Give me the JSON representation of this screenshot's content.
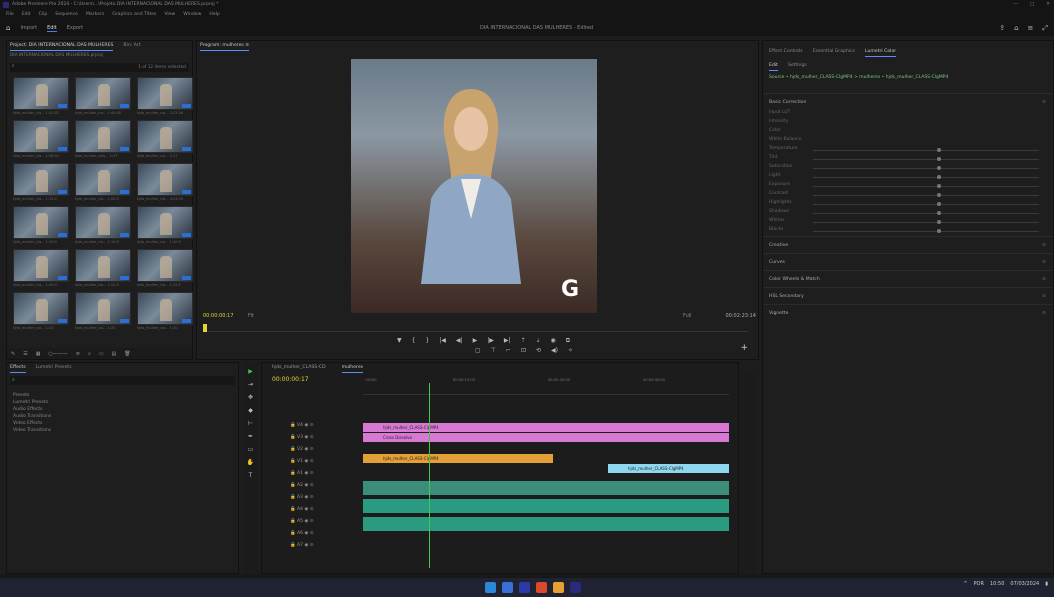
{
  "window": {
    "title": "Adobe Premiere Pro 2024 - C:\\Users\\...\\Projeto DIA INTERNACIONAL DAS MULHERES.prproj *",
    "controls": [
      "—",
      "□",
      "✕"
    ]
  },
  "menu": [
    "File",
    "Edit",
    "Clip",
    "Sequence",
    "Markers",
    "Graphics and Titles",
    "View",
    "Window",
    "Help"
  ],
  "workspace": {
    "tabs": [
      "Import",
      "Edit",
      "Export"
    ],
    "active": "Edit",
    "document_title": "DIA INTERNACIONAL DAS MULHERES - Edited"
  },
  "project": {
    "tab": "Project: DIA INTERNACIONAL DAS MULHERES",
    "tab2": "Bin: Art",
    "file": "DIA INTERNACIONAL DAS MULHERES.prproj",
    "count": "1 of 12 items selected",
    "thumbs": [
      "hjds_mulher_cla... 1:20:02",
      "hjds_mulher_cla... 1:40:00",
      "hjds_mulher_cla... 3:22:26",
      "hjds_mulher_cla... 1:38:02",
      "hjds_mulher_clas... 2:37",
      "hjds_mulher_cla... 2:17",
      "hjds_mulher_cla... 1:12:0",
      "hjds_mulher_cla... 1:00:3",
      "hjds_mulher_cla... 4:24:33",
      "hjds_mulher_cla... 1:10:9",
      "hjds_mulher_cla... 1:14:9",
      "hjds_mulher_cla... 1:10:9",
      "hjds_mulher_cla... 1:40:0",
      "hjds_mulher_cla... 1:22:0",
      "hjds_mulher_cla... 1:22:P",
      "hjds_mulher_cla... 1:20",
      "hjds_mulher_cla... 1:20",
      "hjds_mulher_cla... 1:20"
    ]
  },
  "program": {
    "title": "Program: mulheres ≡",
    "timecode": "00:00:00:17",
    "fit": "Fit",
    "full": "Full",
    "duration": "00:02:23:14"
  },
  "lumetri": {
    "tabs": [
      "Effect Controls",
      "Essential Graphics",
      "Lumetri Color"
    ],
    "active": "Lumetri Color",
    "subtabs": [
      "Edit",
      "Settings"
    ],
    "source": "Source • hjds_mulher_CLASS-ClgMP4  >  mulheres • hjds_mulher_CLASS-ClgMP4",
    "sections": [
      "Basic Correction",
      "Creative",
      "Curves",
      "Color Wheels & Match",
      "HSL Secondary",
      "Vignette"
    ],
    "basic_rows": [
      "Input LUT",
      "Intensity",
      "Color",
      "White Balance",
      "Temperature",
      "Tint",
      "Saturation",
      "Light",
      "Exposure",
      "Contrast",
      "Highlights",
      "Shadows",
      "Whites",
      "Blacks"
    ]
  },
  "effects": {
    "tabs": [
      "Effects",
      "Lumetri Presets"
    ],
    "items": [
      "Presets",
      "Lumetri Presets",
      "Audio Effects",
      "Audio Transitions",
      "Video Effects",
      "Video Transitions"
    ]
  },
  "timeline": {
    "tabs": [
      "hjds_mulher_CLASS-CD",
      "mulheres"
    ],
    "active": "mulheres",
    "timecode": "00:00:00:17",
    "ruler": [
      ":00:00",
      "00:00:15:00",
      "00:00:30:00",
      "00:00:45:00"
    ],
    "clips": [
      {
        "label": "hjds_mulher_CLASS-ClgMP4",
        "color": "#d779d3",
        "row": 0
      },
      {
        "label": "Cross Dissolve",
        "color": "#d779d3",
        "row": 1
      },
      {
        "label": "hjds_mulher_CLASS-ClgMP4",
        "color": "#e2a036",
        "row": 2
      },
      {
        "label": "hjds_mulher_CLASS-ClgMP4",
        "color": "#8dd8f0",
        "row": 3
      }
    ]
  },
  "taskbar": {
    "time": "10:50",
    "date": "07/03/2024",
    "lang": "POR"
  }
}
